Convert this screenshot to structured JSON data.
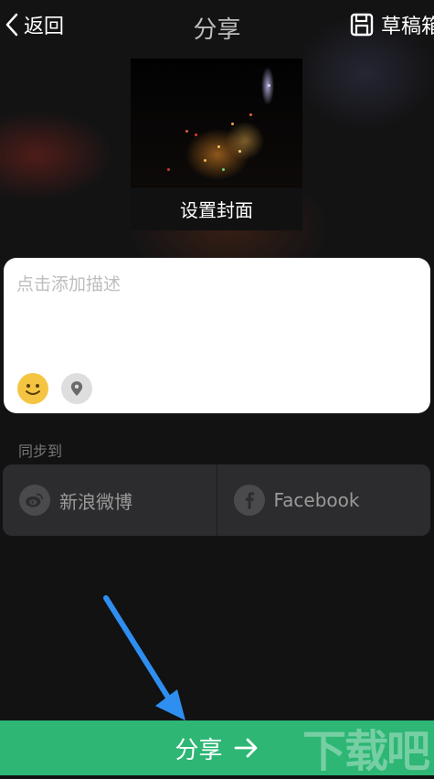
{
  "header": {
    "back_label": "返回",
    "title": "分享",
    "draft_label": "草稿箱"
  },
  "cover": {
    "label": "设置封面"
  },
  "description": {
    "placeholder": "点击添加描述",
    "value": ""
  },
  "icons": {
    "back": "chevron-left-icon",
    "draft": "save-icon",
    "emoji": "smiley-icon",
    "location": "location-pin-icon",
    "weibo": "weibo-icon",
    "facebook": "facebook-icon",
    "share_arrow": "arrow-right-icon"
  },
  "sync": {
    "label": "同步到",
    "options": [
      {
        "label": "新浪微博",
        "icon": "weibo-icon"
      },
      {
        "label": "Facebook",
        "icon": "facebook-icon"
      }
    ]
  },
  "share_button": {
    "label": "分享"
  },
  "colors": {
    "background": "#121213",
    "share_green": "#2db674",
    "annotation_blue": "#2e8ff0",
    "sync_box": "#2c2c2e"
  }
}
